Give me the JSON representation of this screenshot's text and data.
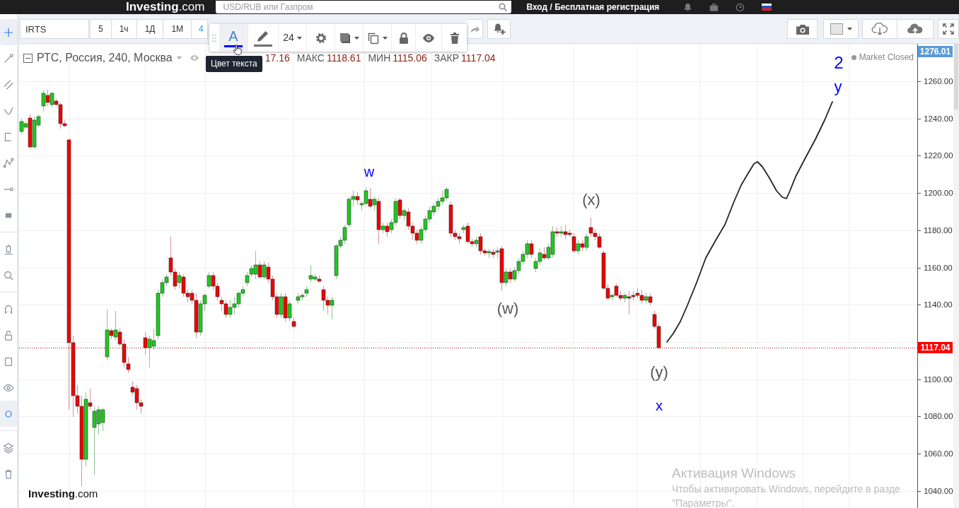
{
  "top_bar": {
    "logo": "**Investing**.com",
    "search": {
      "placeholder": "USD/RUB или Газпром"
    },
    "login": "Вход / Бесплатная регистрация"
  },
  "left_toolbar": {
    "groups": [
      {
        "tools": [
          {
            "kind": "crosshair",
            "active": true
          },
          {
            "kind": "trendline",
            "active": false
          },
          {
            "kind": "channel",
            "active": false
          },
          {
            "kind": "brush",
            "active": false
          },
          {
            "kind": "bracket",
            "active": false
          },
          {
            "kind": "pattern",
            "active": false
          },
          {
            "kind": "hline",
            "active": false
          },
          {
            "kind": "shape",
            "active": false
          }
        ]
      },
      {
        "tools": [
          {
            "kind": "measure",
            "active": false
          },
          {
            "kind": "zoom",
            "active": false
          }
        ]
      },
      {
        "tools": [
          {
            "kind": "magnet",
            "active": false
          },
          {
            "kind": "lock",
            "active": false
          },
          {
            "kind": "frame",
            "active": false
          },
          {
            "kind": "eye",
            "active": false
          },
          {
            "kind": "ring",
            "active": true
          }
        ]
      },
      {
        "tools": [
          {
            "kind": "layers",
            "active": false
          },
          {
            "kind": "trash",
            "active": false
          }
        ]
      }
    ]
  },
  "chart_toolbar": {
    "symbol": "IRTS",
    "intervals": [
      {
        "label": "5",
        "selected": false
      },
      {
        "label": "1ч",
        "selected": false
      },
      {
        "label": "1Д",
        "selected": false
      },
      {
        "label": "1М",
        "selected": false
      },
      {
        "label": "4",
        "selected": true
      }
    ],
    "tools": [
      {
        "kind": "redo"
      },
      {
        "kind": "alert"
      }
    ],
    "actions": [
      {
        "kind": "snapshot"
      },
      {
        "kind": "background"
      },
      {
        "kind": "load"
      },
      {
        "kind": "save"
      },
      {
        "kind": "fullscreen"
      }
    ]
  },
  "text_toolbar": {
    "items": [
      {
        "kind": "textcolor",
        "glyph": "A",
        "color": "#0000ff",
        "hovered": true
      },
      {
        "kind": "linecolor",
        "color": "#707070",
        "hovered": false
      },
      {
        "kind": "fontsize",
        "label": "24",
        "hovered": false
      },
      {
        "kind": "settings",
        "hovered": false
      },
      {
        "kind": "fill",
        "hovered": false
      },
      {
        "kind": "clone",
        "hovered": false
      },
      {
        "kind": "lock",
        "hovered": false
      },
      {
        "kind": "visibility",
        "hovered": false
      },
      {
        "kind": "delete",
        "hovered": false
      }
    ],
    "tooltip": "Цвет текста"
  },
  "legend": {
    "title": "РТС, Россия, 240, Москва",
    "values": [
      {
        "value": "17.16"
      },
      {
        "label": "МАКС",
        "value": "1118.61"
      },
      {
        "label": "МИН",
        "value": "1115.06"
      },
      {
        "label": "ЗАКР",
        "value": "1117.04"
      }
    ]
  },
  "market_status": "Market Closed",
  "chart": {
    "wave_labels": [
      {
        "text": "2",
        "color": "#0000ff"
      },
      {
        "text": "y",
        "color": "#0000ff"
      },
      {
        "text": "w",
        "color": "#0000ff"
      },
      {
        "text": "(x)",
        "color": "#555555"
      },
      {
        "text": "(w)",
        "color": "#555555"
      },
      {
        "text": "(y)",
        "color": "#555555"
      },
      {
        "text": "x",
        "color": "#0000ff"
      }
    ],
    "logo": "**Investing**.com"
  },
  "price_axis": {
    "labels": [
      "1260.00",
      "1240.00",
      "1220.00",
      "1200.00",
      "1180.00",
      "1160.00",
      "1140.00",
      "1100.00",
      "1080.00",
      "1060.00",
      "1040.00"
    ],
    "markers": [
      {
        "value": "1276.01",
        "color": "#5b9bd5"
      },
      {
        "value": "1117.04",
        "color": "#ff0000"
      }
    ]
  },
  "windows_notice": {
    "title": "Активация Windows",
    "lines": [
      "Чтобы активировать Windows, перейдите в разде",
      "\"Параметры\"."
    ]
  }
}
